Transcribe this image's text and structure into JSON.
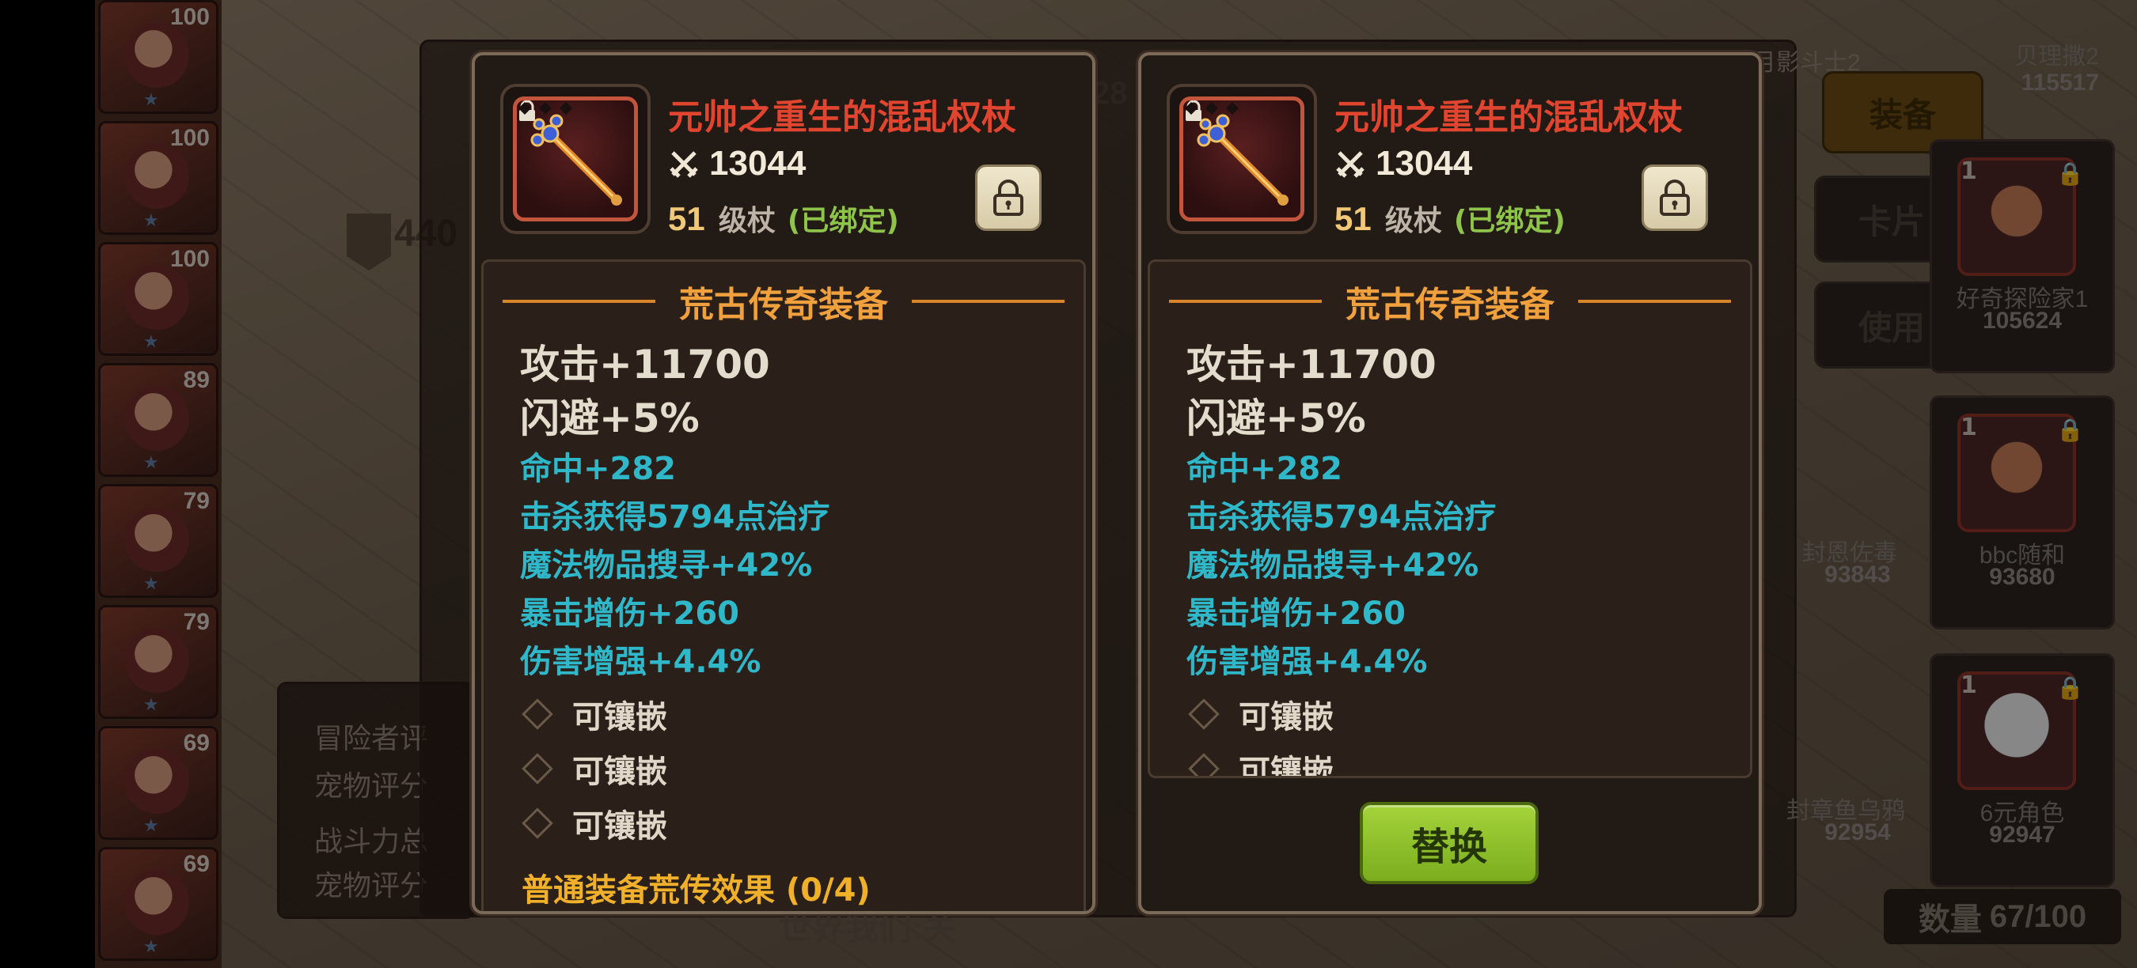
{
  "background": {
    "roster_levels": [
      "100",
      "100",
      "100",
      "89",
      "79",
      "79",
      "69",
      "69"
    ],
    "partial_text": {
      "power_fragment": "440",
      "eval_lines": [
        "冒险者评",
        "宠物评分",
        "战斗力总",
        "宠物评分"
      ],
      "bottom_fragment": "世界我们:关",
      "top_right_fragment": "月影斗士2",
      "gold_value_fragment": "28"
    },
    "side_buttons": {
      "equip": "装备",
      "card": "卡片",
      "use": "使用"
    },
    "inventory_cards": [
      {
        "num": "",
        "name": "贝理撒2",
        "score": "115517"
      },
      {
        "num": "1",
        "name": "好奇探险家1",
        "score": "105624"
      },
      {
        "num": "",
        "name": "封恩佐毒",
        "score": "93843"
      },
      {
        "num": "1",
        "name": "bbc随和",
        "score": "93680"
      },
      {
        "num": "",
        "name": "封章鱼乌鸦",
        "score": "92954"
      },
      {
        "num": "1",
        "name": "6元角色",
        "score": "92947"
      }
    ],
    "inventory_count_label": "数量",
    "inventory_count_value": "67/100"
  },
  "panels": [
    {
      "item_name": "元帅之重生的混乱权杖",
      "power": "13044",
      "level": "51",
      "weapon_type": "级杖",
      "bound_status": "(已绑定)",
      "section_title": "荒古传奇装备",
      "main_attrs": [
        "攻击+11700",
        "闪避+5%"
      ],
      "sub_attrs": [
        "命中+282",
        "击杀获得5794点治疗",
        "魔法物品搜寻+42%",
        "暴击增伤+260",
        "伤害增强+4.4%"
      ],
      "sockets": [
        "可镶嵌",
        "可镶嵌",
        "可镶嵌"
      ],
      "set_effect": "普通装备荒传效果 (0/4)"
    },
    {
      "item_name": "元帅之重生的混乱权杖",
      "power": "13044",
      "level": "51",
      "weapon_type": "级杖",
      "bound_status": "(已绑定)",
      "section_title": "荒古传奇装备",
      "main_attrs": [
        "攻击+11700",
        "闪避+5%"
      ],
      "sub_attrs": [
        "命中+282",
        "击杀获得5794点治疗",
        "魔法物品搜寻+42%",
        "暴击增伤+260",
        "伤害增强+4.4%"
      ],
      "sockets": [
        "可镶嵌",
        "可镶嵌"
      ]
    }
  ],
  "replace_button": "替换",
  "colors": {
    "item_name": "#e2452f",
    "section_title": "#f0a03c",
    "sub_attr": "#2fb8c9",
    "bound": "#8ec44a",
    "set_effect": "#f0b02a",
    "replace_button": "#a4d33a"
  },
  "icons": {
    "power": "crossed-swords-icon",
    "lock": "padlock-icon",
    "item": "scepter-icon",
    "socket": "diamond-socket-icon"
  }
}
